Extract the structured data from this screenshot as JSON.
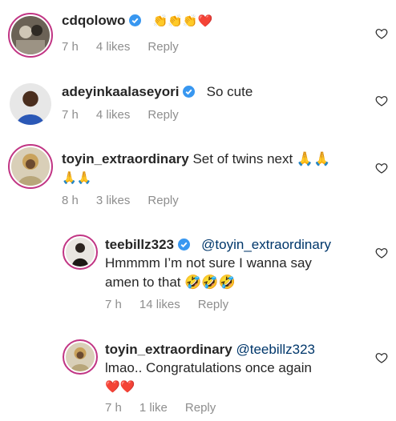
{
  "comments": [
    {
      "username": "cdqolowo",
      "text": "👏👏👏❤️",
      "time": "7 h",
      "likes": "4 likes",
      "reply": "Reply"
    },
    {
      "username": "adeyinkaalaseyori",
      "text": "So cute",
      "time": "7 h",
      "likes": "4 likes",
      "reply": "Reply"
    },
    {
      "username": "toyin_extraordinary",
      "text": "Set of twins next 🙏🙏",
      "text2": "🙏🙏",
      "time": "8 h",
      "likes": "3 likes",
      "reply": "Reply"
    },
    {
      "username": "teebillz323",
      "mention": "@toyin_extraordinary",
      "text": "Hmmmm I’m not sure I wanna say",
      "text2": "amen to that 🤣🤣🤣",
      "time": "7 h",
      "likes": "14 likes",
      "reply": "Reply"
    },
    {
      "username": "toyin_extraordinary",
      "mention": "@teebillz323",
      "text": "lmao.. Congratulations once again",
      "text2": "❤️❤️",
      "time": "7 h",
      "likes": "1 like",
      "reply": "Reply"
    }
  ],
  "colors": {
    "text": "#262626",
    "muted": "#8e8e8e",
    "mention": "#00376b",
    "verified": "#3897f0",
    "ring": "#c13584"
  },
  "icons": [
    "verified-badge-icon",
    "heart-outline-icon",
    "clap-emoji",
    "red-heart-emoji",
    "praying-hands-emoji",
    "rolling-laughing-emoji"
  ]
}
